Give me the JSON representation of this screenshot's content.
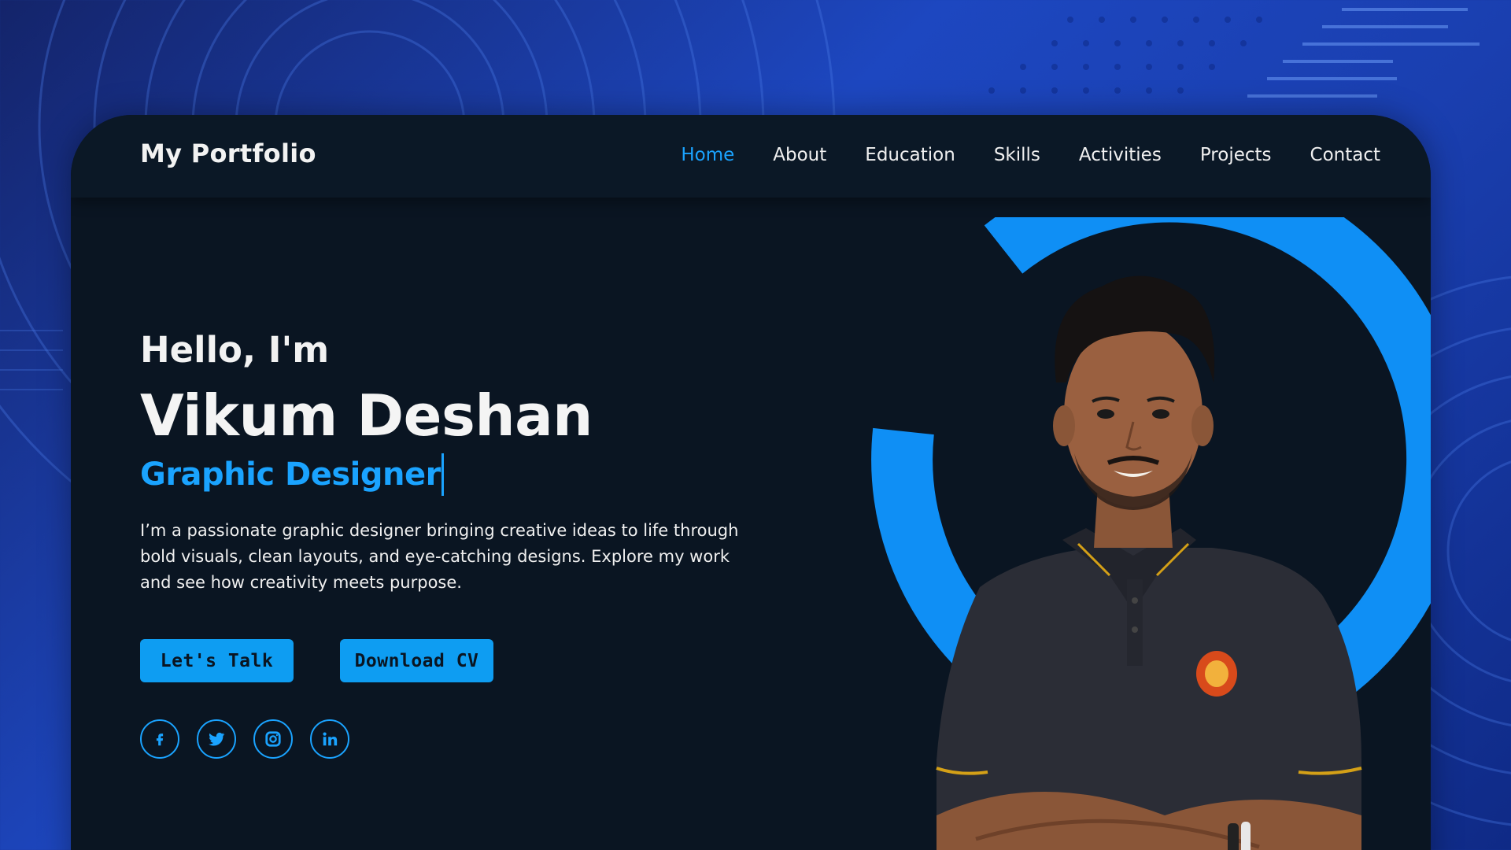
{
  "brand": {
    "title": "My Portfolio"
  },
  "nav": {
    "items": [
      {
        "label": "Home",
        "active": true
      },
      {
        "label": "About",
        "active": false
      },
      {
        "label": "Education",
        "active": false
      },
      {
        "label": "Skills",
        "active": false
      },
      {
        "label": "Activities",
        "active": false
      },
      {
        "label": "Projects",
        "active": false
      },
      {
        "label": "Contact",
        "active": false
      }
    ]
  },
  "hero": {
    "greeting": "Hello, I'm",
    "name": "Vikum Deshan",
    "role": "Graphic Designer",
    "bio_lines": [
      "I’m a passionate graphic designer bringing creative ideas to life through",
      "bold visuals, clean layouts, and eye-catching designs. Explore my work",
      "and see how creativity meets purpose."
    ]
  },
  "buttons": {
    "talk_label": "Let's Talk",
    "cv_label": "Download CV"
  },
  "socials": [
    {
      "icon": "facebook-icon"
    },
    {
      "icon": "twitter-icon"
    },
    {
      "icon": "instagram-icon"
    },
    {
      "icon": "linkedin-icon"
    }
  ],
  "colors": {
    "accent": "#1aa3ff",
    "card_bg": "#0a1522",
    "page_bg": "#1d47c0",
    "text": "#f2f2f2"
  }
}
